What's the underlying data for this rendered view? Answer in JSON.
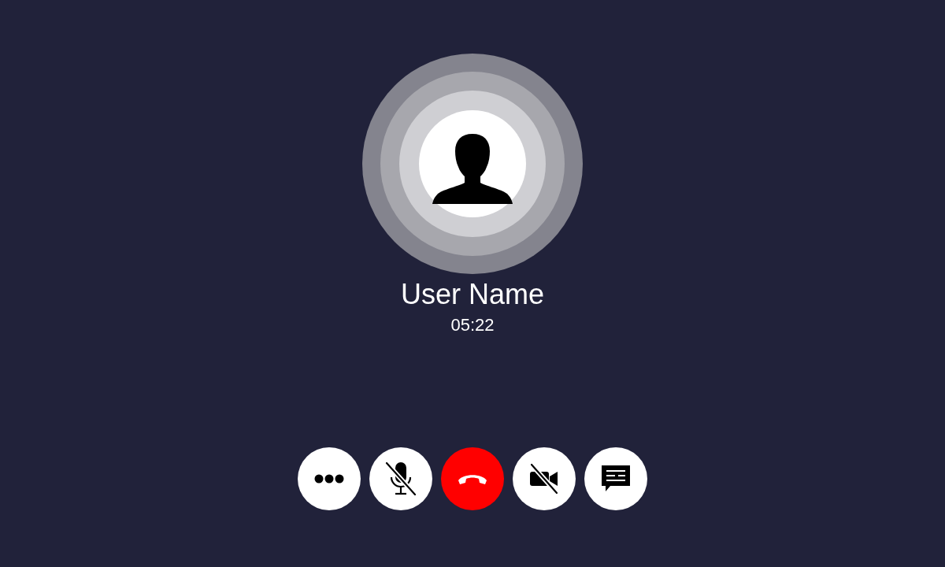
{
  "caller": {
    "name": "User Name",
    "duration": "05:22"
  },
  "controls": [
    {
      "kind": "more"
    },
    {
      "kind": "mic",
      "off": true
    },
    {
      "kind": "end"
    },
    {
      "kind": "camera",
      "off": true
    },
    {
      "kind": "message"
    }
  ]
}
